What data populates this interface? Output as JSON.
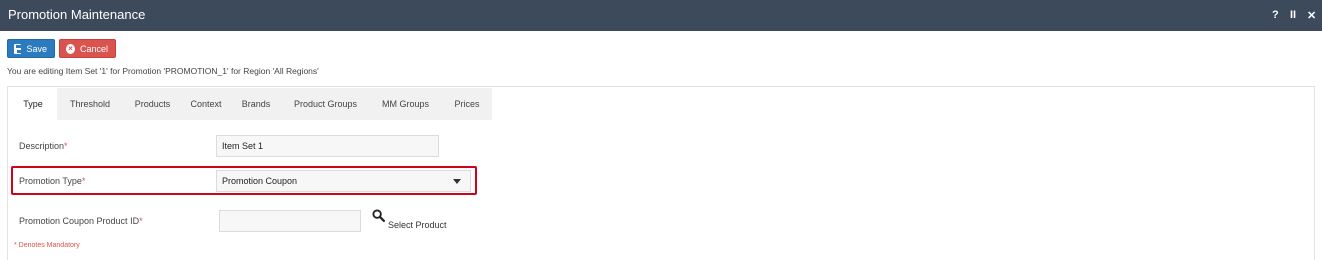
{
  "window": {
    "title": "Promotion Maintenance",
    "help_label": "?",
    "pause_label": "II",
    "close_label": "✕"
  },
  "toolbar": {
    "save_label": "Save",
    "cancel_label": "Cancel"
  },
  "editing_message": "You are editing Item Set '1' for Promotion 'PROMOTION_1' for Region 'All Regions'",
  "tabs": [
    {
      "label": "Type",
      "active": true
    },
    {
      "label": "Threshold"
    },
    {
      "label": "Products"
    },
    {
      "label": "Context"
    },
    {
      "label": "Brands"
    },
    {
      "label": "Product Groups"
    },
    {
      "label": "MM Groups"
    },
    {
      "label": "Prices"
    }
  ],
  "form": {
    "description_label": "Description",
    "description_value": "Item Set 1",
    "promotion_type_label": "Promotion Type",
    "promotion_type_value": "Promotion Coupon",
    "coupon_product_label": "Promotion Coupon Product ID",
    "coupon_product_value": "",
    "required_marker": "*",
    "select_product_label": "Select Product",
    "mandatory_note": "* Denotes Mandatory"
  },
  "colors": {
    "titlebar": "#3c4a5b",
    "save_button": "#2c7bbf",
    "cancel_button": "#d9534f",
    "highlight_border": "#d0021b",
    "required": "#d9534f"
  }
}
